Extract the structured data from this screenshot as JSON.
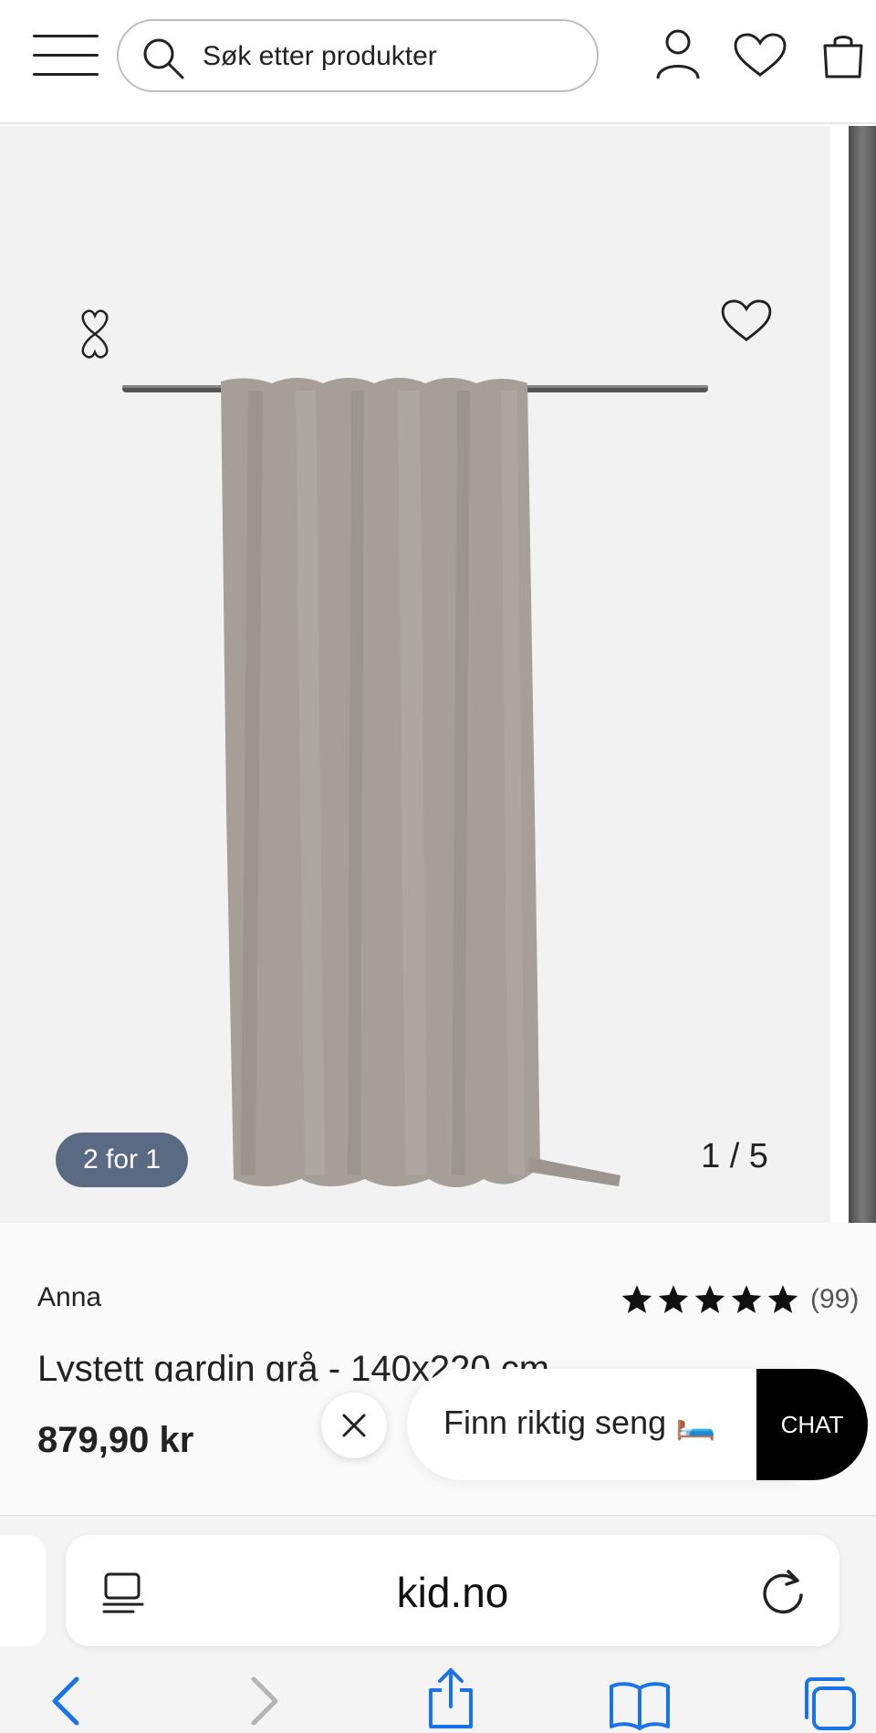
{
  "header": {
    "search_placeholder": "Søk etter produkter",
    "icons": [
      "menu-icon",
      "search-icon",
      "account-icon",
      "heart-icon",
      "bag-icon"
    ]
  },
  "gallery": {
    "promo_badge": "2 for 1",
    "image_counter": "1 / 5",
    "current_image": 1,
    "total_images": 5,
    "image_subject": "grey blackout curtain on rod",
    "badge_color": "#5a6a82"
  },
  "product": {
    "brand": "Anna",
    "rating": 5,
    "review_count": "(99)",
    "title": "Lystett gardin grå - 140x220 cm",
    "price": "879,90 kr"
  },
  "chat": {
    "prompt": "Finn riktig seng 🛏️",
    "button_label": "CHAT"
  },
  "browser": {
    "url": "kid.no",
    "accent": "#1a73e8"
  }
}
